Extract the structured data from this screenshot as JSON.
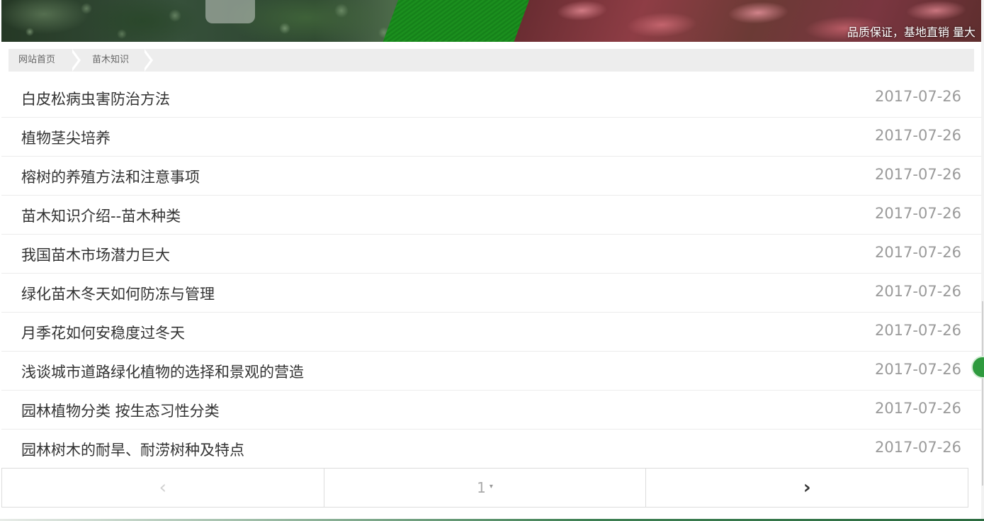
{
  "banner": {
    "slogan": "品质保证，基地直销 量大"
  },
  "breadcrumb": {
    "items": [
      {
        "label": "网站首页"
      },
      {
        "label": "苗木知识"
      }
    ]
  },
  "articles": [
    {
      "title": "白皮松病虫害防治方法",
      "date": "2017-07-26"
    },
    {
      "title": "植物茎尖培养",
      "date": "2017-07-26"
    },
    {
      "title": "榕树的养殖方法和注意事项",
      "date": "2017-07-26"
    },
    {
      "title": "苗木知识介绍--苗木种类",
      "date": "2017-07-26"
    },
    {
      "title": "我国苗木市场潜力巨大",
      "date": "2017-07-26"
    },
    {
      "title": "绿化苗木冬天如何防冻与管理",
      "date": "2017-07-26"
    },
    {
      "title": "月季花如何安稳度过冬天",
      "date": "2017-07-26"
    },
    {
      "title": "浅谈城市道路绿化植物的选择和景观的营造",
      "date": "2017-07-26"
    },
    {
      "title": "园林植物分类 按生态习性分类",
      "date": "2017-07-26"
    },
    {
      "title": "园林树木的耐旱、耐涝树种及特点",
      "date": "2017-07-26"
    }
  ],
  "pagination": {
    "prev_glyph": "‹",
    "current_page": "1",
    "caret_glyph": "▾",
    "next_glyph": "›"
  },
  "colors": {
    "accent_green": "#1b8f1e",
    "title_text": "#333333",
    "date_text": "#9a9a9a",
    "breadcrumb_bg": "#ededed"
  }
}
